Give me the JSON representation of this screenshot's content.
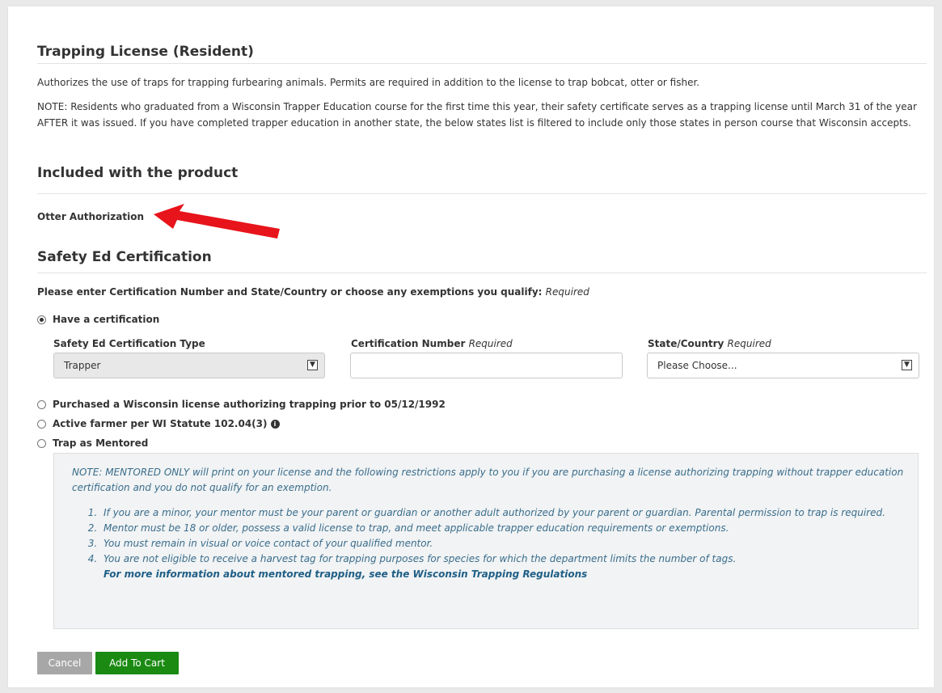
{
  "license": {
    "title": "Trapping License (Resident)",
    "description": "Authorizes the use of traps for trapping furbearing animals. Permits are required in addition to the license to trap bobcat, otter or fisher.",
    "note": "NOTE: Residents who graduated from a Wisconsin Trapper Education course for the first time this year, their safety certificate serves as a trapping license until March 31 of the year AFTER it was issued. If you have completed trapper education in another state, the below states list is filtered to include only those states in person course that Wisconsin accepts."
  },
  "included": {
    "heading": "Included with the product",
    "item": "Otter Authorization"
  },
  "safety": {
    "heading": "Safety Ed Certification",
    "prompt": "Please enter Certification Number and State/Country or choose any exemptions you qualify:",
    "prompt_required": "Required",
    "option_have_cert": "Have a certification",
    "type_label": "Safety Ed Certification Type",
    "type_value": "Trapper",
    "cert_number_label": "Certification Number",
    "cert_number_required": "Required",
    "cert_number_value": "",
    "state_label": "State/Country",
    "state_required": "Required",
    "state_value": "Please Choose...",
    "option_purchased": "Purchased a Wisconsin license authorizing trapping prior to 05/12/1992",
    "option_farmer": "Active farmer per WI Statute 102.04(3)",
    "option_mentored": "Trap as Mentored",
    "selected_option": "Have a certification"
  },
  "mentored_note": {
    "intro": "NOTE: MENTORED ONLY will print on your license and the following restrictions apply to you if you are purchasing a license authorizing trapping without trapper education certification and you do not qualify for an exemption.",
    "items": [
      "If you are a minor, your mentor must be your parent or guardian or another adult authorized by your parent or guardian.  Parental permission to trap is required.",
      "Mentor must be 18 or older, possess a valid license to trap, and meet applicable trapper education requirements or exemptions.",
      "You must remain in visual or voice contact of your qualified mentor.",
      "You are not eligible to receive a harvest tag for trapping purposes for species for which the department limits the number of tags."
    ],
    "link": "For more information about mentored trapping, see the Wisconsin Trapping Regulations"
  },
  "actions": {
    "cancel": "Cancel",
    "add_to_cart": "Add To Cart"
  },
  "colors": {
    "add_to_cart": "#1a8a12",
    "cancel": "#a7a7a7",
    "arrow": "#e8141b",
    "note_text": "#3a6d8c"
  },
  "icons": {
    "info": "info-icon",
    "dropdown": "chevron-down-icon",
    "annotation": "red-arrow-icon"
  }
}
